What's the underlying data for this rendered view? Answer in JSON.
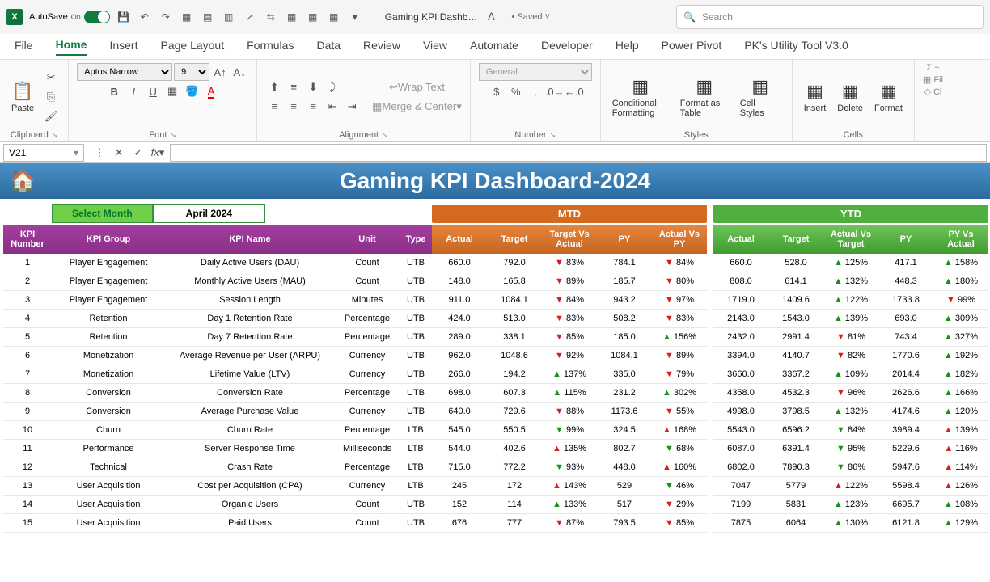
{
  "titlebar": {
    "autosave_label": "AutoSave",
    "autosave_state": "On",
    "doc_title": "Gaming KPI Dashb…",
    "saved": "• Saved ˅",
    "search_placeholder": "Search"
  },
  "ribbon_tabs": [
    "File",
    "Home",
    "Insert",
    "Page Layout",
    "Formulas",
    "Data",
    "Review",
    "View",
    "Automate",
    "Developer",
    "Help",
    "Power Pivot",
    "PK's Utility Tool V3.0"
  ],
  "ribbon": {
    "clipboard_label": "Clipboard",
    "paste_label": "Paste",
    "font_label": "Font",
    "font_name": "Aptos Narrow",
    "font_size": "9",
    "alignment_label": "Alignment",
    "wrap_text": "Wrap Text",
    "merge_center": "Merge & Center",
    "number_label": "Number",
    "number_format": "General",
    "styles_label": "Styles",
    "cond_fmt": "Conditional Formatting",
    "fmt_table": "Format as Table",
    "cell_styles": "Cell Styles",
    "cells_label": "Cells",
    "insert": "Insert",
    "delete": "Delete",
    "format": "Format"
  },
  "formula": {
    "name_box": "V21"
  },
  "dashboard": {
    "title": "Gaming KPI Dashboard-2024",
    "select_month_label": "Select Month",
    "selected_month": "April 2024",
    "mtd_label": "MTD",
    "ytd_label": "YTD"
  },
  "info_headers": [
    "KPI Number",
    "KPI Group",
    "KPI Name",
    "Unit",
    "Type"
  ],
  "mtd_headers": [
    "Actual",
    "Target",
    "Target Vs Actual",
    "PY",
    "Actual Vs PY"
  ],
  "ytd_headers": [
    "Actual",
    "Target",
    "Actual Vs Target",
    "PY",
    "PY Vs Actual"
  ],
  "rows": [
    {
      "num": "1",
      "group": "Player Engagement",
      "name": "Daily Active Users (DAU)",
      "unit": "Count",
      "type": "UTB",
      "mtd": {
        "actual": "660.0",
        "target": "792.0",
        "tva_dir": "down",
        "tva": "83%",
        "py": "784.1",
        "avp_dir": "down",
        "avp": "84%"
      },
      "ytd": {
        "actual": "660.0",
        "target": "528.0",
        "avt_dir": "up",
        "avt": "125%",
        "py": "417.1",
        "pva_dir": "up",
        "pva": "158%"
      }
    },
    {
      "num": "2",
      "group": "Player Engagement",
      "name": "Monthly Active Users (MAU)",
      "unit": "Count",
      "type": "UTB",
      "mtd": {
        "actual": "148.0",
        "target": "165.8",
        "tva_dir": "down",
        "tva": "89%",
        "py": "185.7",
        "avp_dir": "down",
        "avp": "80%"
      },
      "ytd": {
        "actual": "808.0",
        "target": "614.1",
        "avt_dir": "up",
        "avt": "132%",
        "py": "448.3",
        "pva_dir": "up",
        "pva": "180%"
      }
    },
    {
      "num": "3",
      "group": "Player Engagement",
      "name": "Session Length",
      "unit": "Minutes",
      "type": "UTB",
      "mtd": {
        "actual": "911.0",
        "target": "1084.1",
        "tva_dir": "down",
        "tva": "84%",
        "py": "943.2",
        "avp_dir": "down",
        "avp": "97%"
      },
      "ytd": {
        "actual": "1719.0",
        "target": "1409.6",
        "avt_dir": "up",
        "avt": "122%",
        "py": "1733.8",
        "pva_dir": "down",
        "pva": "99%"
      }
    },
    {
      "num": "4",
      "group": "Retention",
      "name": "Day 1 Retention Rate",
      "unit": "Percentage",
      "type": "UTB",
      "mtd": {
        "actual": "424.0",
        "target": "513.0",
        "tva_dir": "down",
        "tva": "83%",
        "py": "508.2",
        "avp_dir": "down",
        "avp": "83%"
      },
      "ytd": {
        "actual": "2143.0",
        "target": "1543.0",
        "avt_dir": "up",
        "avt": "139%",
        "py": "693.0",
        "pva_dir": "up",
        "pva": "309%"
      }
    },
    {
      "num": "5",
      "group": "Retention",
      "name": "Day 7 Retention Rate",
      "unit": "Percentage",
      "type": "UTB",
      "mtd": {
        "actual": "289.0",
        "target": "338.1",
        "tva_dir": "down",
        "tva": "85%",
        "py": "185.0",
        "avp_dir": "up",
        "avp": "156%"
      },
      "ytd": {
        "actual": "2432.0",
        "target": "2991.4",
        "avt_dir": "down",
        "avt": "81%",
        "py": "743.4",
        "pva_dir": "up",
        "pva": "327%"
      }
    },
    {
      "num": "6",
      "group": "Monetization",
      "name": "Average Revenue per User (ARPU)",
      "unit": "Currency",
      "type": "UTB",
      "mtd": {
        "actual": "962.0",
        "target": "1048.6",
        "tva_dir": "down",
        "tva": "92%",
        "py": "1084.1",
        "avp_dir": "down",
        "avp": "89%"
      },
      "ytd": {
        "actual": "3394.0",
        "target": "4140.7",
        "avt_dir": "down",
        "avt": "82%",
        "py": "1770.6",
        "pva_dir": "up",
        "pva": "192%"
      }
    },
    {
      "num": "7",
      "group": "Monetization",
      "name": "Lifetime Value (LTV)",
      "unit": "Currency",
      "type": "UTB",
      "mtd": {
        "actual": "266.0",
        "target": "194.2",
        "tva_dir": "up",
        "tva": "137%",
        "py": "335.0",
        "avp_dir": "down",
        "avp": "79%"
      },
      "ytd": {
        "actual": "3660.0",
        "target": "3367.2",
        "avt_dir": "up",
        "avt": "109%",
        "py": "2014.4",
        "pva_dir": "up",
        "pva": "182%"
      }
    },
    {
      "num": "8",
      "group": "Conversion",
      "name": "Conversion Rate",
      "unit": "Percentage",
      "type": "UTB",
      "mtd": {
        "actual": "698.0",
        "target": "607.3",
        "tva_dir": "up",
        "tva": "115%",
        "py": "231.2",
        "avp_dir": "up",
        "avp": "302%"
      },
      "ytd": {
        "actual": "4358.0",
        "target": "4532.3",
        "avt_dir": "down",
        "avt": "96%",
        "py": "2626.6",
        "pva_dir": "up",
        "pva": "166%"
      }
    },
    {
      "num": "9",
      "group": "Conversion",
      "name": "Average Purchase Value",
      "unit": "Currency",
      "type": "UTB",
      "mtd": {
        "actual": "640.0",
        "target": "729.6",
        "tva_dir": "down",
        "tva": "88%",
        "py": "1173.6",
        "avp_dir": "down",
        "avp": "55%"
      },
      "ytd": {
        "actual": "4998.0",
        "target": "3798.5",
        "avt_dir": "up",
        "avt": "132%",
        "py": "4174.6",
        "pva_dir": "up",
        "pva": "120%"
      }
    },
    {
      "num": "10",
      "group": "Churn",
      "name": "Churn Rate",
      "unit": "Percentage",
      "type": "LTB",
      "mtd": {
        "actual": "545.0",
        "target": "550.5",
        "tva_dir": "down-green",
        "tva": "99%",
        "py": "324.5",
        "avp_dir": "up-red",
        "avp": "168%"
      },
      "ytd": {
        "actual": "5543.0",
        "target": "6596.2",
        "avt_dir": "down-green",
        "avt": "84%",
        "py": "3989.4",
        "pva_dir": "up-red",
        "pva": "139%"
      }
    },
    {
      "num": "11",
      "group": "Performance",
      "name": "Server Response Time",
      "unit": "Milliseconds",
      "type": "LTB",
      "mtd": {
        "actual": "544.0",
        "target": "402.6",
        "tva_dir": "up-red",
        "tva": "135%",
        "py": "802.7",
        "avp_dir": "down-green",
        "avp": "68%"
      },
      "ytd": {
        "actual": "6087.0",
        "target": "6391.4",
        "avt_dir": "down-green",
        "avt": "95%",
        "py": "5229.6",
        "pva_dir": "up-red",
        "pva": "116%"
      }
    },
    {
      "num": "12",
      "group": "Technical",
      "name": "Crash Rate",
      "unit": "Percentage",
      "type": "LTB",
      "mtd": {
        "actual": "715.0",
        "target": "772.2",
        "tva_dir": "down-green",
        "tva": "93%",
        "py": "448.0",
        "avp_dir": "up-red",
        "avp": "160%"
      },
      "ytd": {
        "actual": "6802.0",
        "target": "7890.3",
        "avt_dir": "down-green",
        "avt": "86%",
        "py": "5947.6",
        "pva_dir": "up-red",
        "pva": "114%"
      }
    },
    {
      "num": "13",
      "group": "User Acquisition",
      "name": "Cost per Acquisition (CPA)",
      "unit": "Currency",
      "type": "LTB",
      "mtd": {
        "actual": "245",
        "target": "172",
        "tva_dir": "up-red",
        "tva": "143%",
        "py": "529",
        "avp_dir": "down-green",
        "avp": "46%"
      },
      "ytd": {
        "actual": "7047",
        "target": "5779",
        "avt_dir": "up-red",
        "avt": "122%",
        "py": "5598.4",
        "pva_dir": "up-red",
        "pva": "126%"
      }
    },
    {
      "num": "14",
      "group": "User Acquisition",
      "name": "Organic Users",
      "unit": "Count",
      "type": "UTB",
      "mtd": {
        "actual": "152",
        "target": "114",
        "tva_dir": "up",
        "tva": "133%",
        "py": "517",
        "avp_dir": "down",
        "avp": "29%"
      },
      "ytd": {
        "actual": "7199",
        "target": "5831",
        "avt_dir": "up",
        "avt": "123%",
        "py": "6695.7",
        "pva_dir": "up",
        "pva": "108%"
      }
    },
    {
      "num": "15",
      "group": "User Acquisition",
      "name": "Paid Users",
      "unit": "Count",
      "type": "UTB",
      "mtd": {
        "actual": "676",
        "target": "777",
        "tva_dir": "down",
        "tva": "87%",
        "py": "793.5",
        "avp_dir": "down",
        "avp": "85%"
      },
      "ytd": {
        "actual": "7875",
        "target": "6064",
        "avt_dir": "up",
        "avt": "130%",
        "py": "6121.8",
        "pva_dir": "up",
        "pva": "129%"
      }
    }
  ]
}
